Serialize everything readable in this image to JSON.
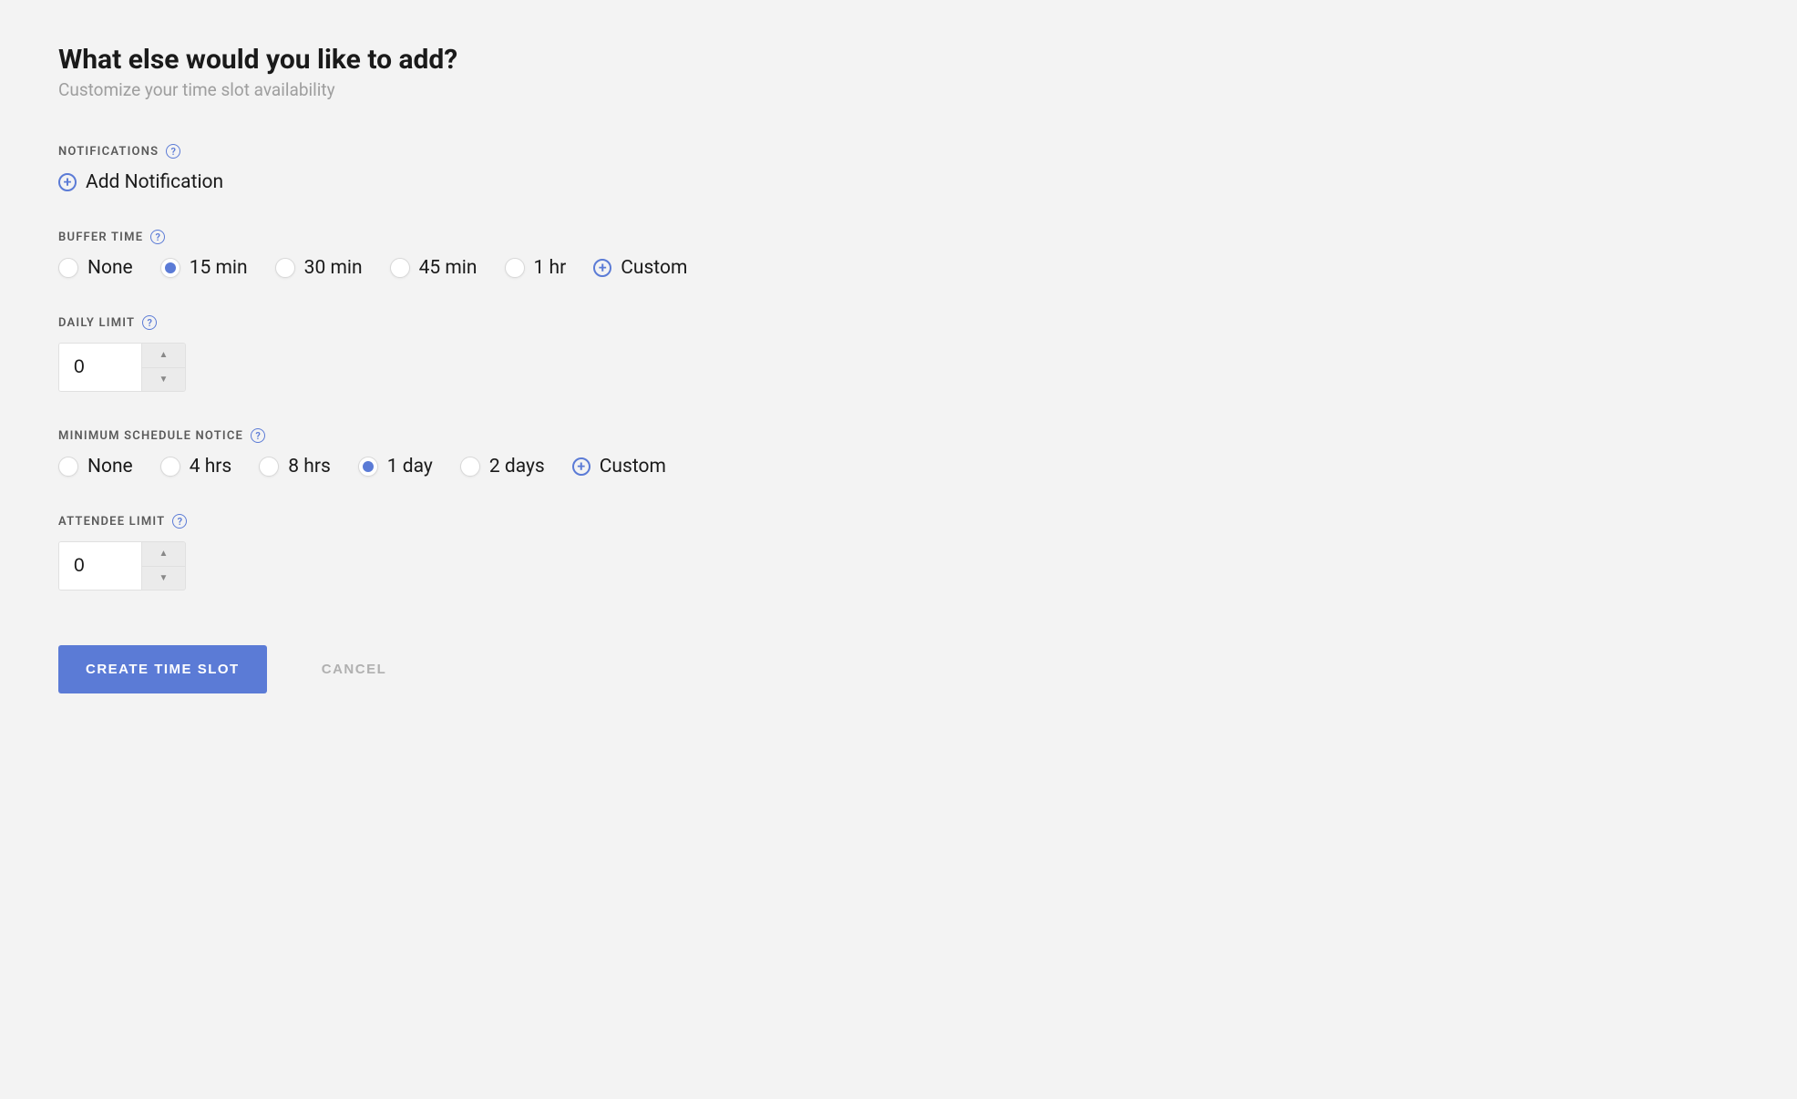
{
  "header": {
    "title": "What else would you like to add?",
    "subtitle": "Customize your time slot availability"
  },
  "notifications": {
    "label": "Notifications",
    "add_label": "Add Notification"
  },
  "buffer_time": {
    "label": "Buffer Time",
    "selected": "15 min",
    "options": [
      "None",
      "15 min",
      "30 min",
      "45 min",
      "1 hr"
    ],
    "custom_label": "Custom"
  },
  "daily_limit": {
    "label": "Daily Limit",
    "value": "0"
  },
  "min_schedule_notice": {
    "label": "Minimum Schedule Notice",
    "selected": "1 day",
    "options": [
      "None",
      "4 hrs",
      "8 hrs",
      "1 day",
      "2 days"
    ],
    "custom_label": "Custom"
  },
  "attendee_limit": {
    "label": "Attendee Limit",
    "value": "0"
  },
  "actions": {
    "primary": "Create Time Slot",
    "cancel": "Cancel"
  }
}
